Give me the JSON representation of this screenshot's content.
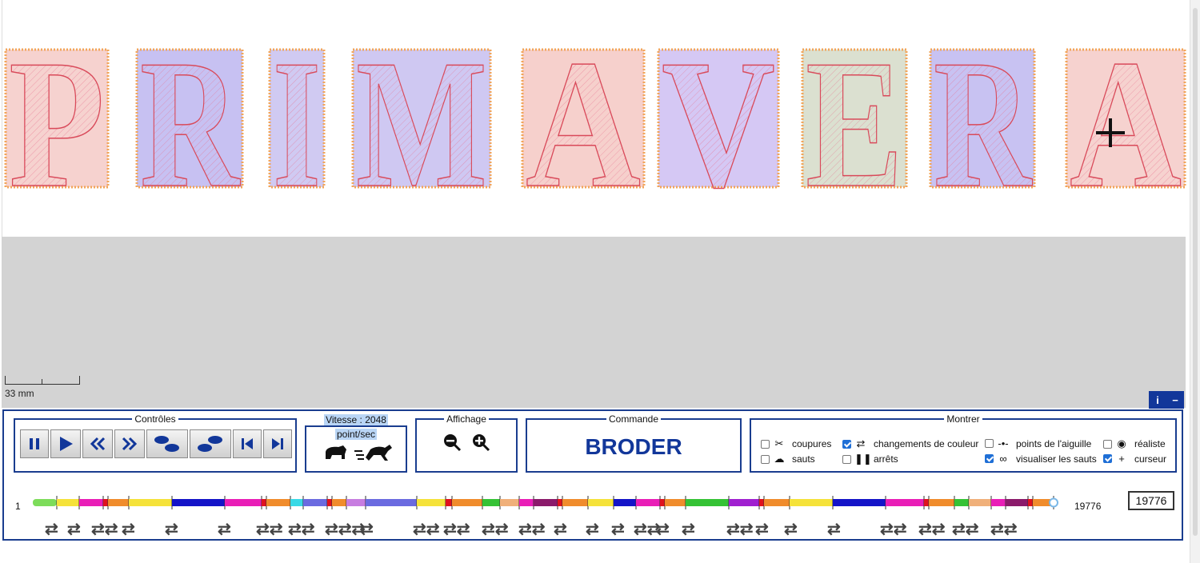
{
  "design": {
    "letters": [
      "P",
      "R",
      "I",
      "M",
      "A",
      "V",
      "E",
      "R",
      "A"
    ]
  },
  "scale": {
    "label": "33 mm"
  },
  "header_buttons": {
    "info": "i",
    "minimize": "−"
  },
  "controls": {
    "legend": "Contrôles",
    "buttons": [
      "pause-icon",
      "play-icon",
      "rewind-icon",
      "fast-forward-icon",
      "step-back-icon",
      "step-forward-icon",
      "first-icon",
      "last-icon"
    ]
  },
  "speed": {
    "line1": "Vitesse : 2048",
    "line2": "point/sec"
  },
  "display": {
    "legend": "Affichage"
  },
  "command": {
    "legend": "Commande",
    "label": "BRODER"
  },
  "show": {
    "legend": "Montrer",
    "options": [
      {
        "label": "coupures",
        "checked": false,
        "icon": "scissors-icon"
      },
      {
        "label": "sauts",
        "checked": false,
        "icon": "jump-icon"
      },
      {
        "label": "changements de couleur",
        "checked": true,
        "icon": "color-change-icon"
      },
      {
        "label": "arrêts",
        "checked": false,
        "icon": "stop-icon"
      },
      {
        "label": "points de l'aiguille",
        "checked": false,
        "icon": "needle-point-icon"
      },
      {
        "label": "visualiser les sauts",
        "checked": true,
        "icon": "link-icon"
      },
      {
        "label": "réaliste",
        "checked": false,
        "icon": "eye-icon"
      },
      {
        "label": "curseur",
        "checked": true,
        "icon": "cursor-icon"
      }
    ]
  },
  "timeline": {
    "start": "1",
    "end": "19776",
    "current": "19776",
    "colors": [
      "#7ddc5a",
      "#f5e23a",
      "#e91eb7",
      "#e0121e",
      "#f08c2c",
      "#f5e23a",
      "#1414c8",
      "#e91eb7",
      "#e0121e",
      "#f08c2c",
      "#39d9e6",
      "#6b6be0",
      "#e0121e",
      "#f08c2c",
      "#c77de0",
      "#6b6be0",
      "#f5e23a",
      "#e0121e",
      "#f08c2c",
      "#35c235",
      "#f0b07a",
      "#e91eb7",
      "#8b1a6b",
      "#e0121e",
      "#f08c2c",
      "#f5e23a",
      "#1414c8",
      "#e91eb7",
      "#e0121e",
      "#f08c2c",
      "#35c235",
      "#a020d0",
      "#e0121e",
      "#f08c2c",
      "#f5e23a",
      "#1414c8",
      "#e91eb7",
      "#e0121e",
      "#f08c2c",
      "#35c235",
      "#f0b07a",
      "#e91eb7",
      "#8b1a6b",
      "#e0121e",
      "#f08c2c"
    ],
    "widths": [
      30,
      28,
      30,
      6,
      26,
      54,
      66,
      46,
      6,
      30,
      16,
      30,
      6,
      18,
      24,
      64,
      36,
      8,
      38,
      22,
      24,
      18,
      30,
      6,
      32,
      32,
      28,
      30,
      6,
      26,
      54,
      38,
      6,
      32,
      54,
      66,
      48,
      6,
      32,
      18,
      28,
      18,
      28,
      6,
      26
    ],
    "arrows": [
      "⇄",
      "⇄",
      "⇄⇄",
      "⇄",
      "⇄",
      "⇄",
      "⇄⇄",
      "⇄⇄",
      "⇄⇄⇄",
      "⇄",
      "⇄⇄",
      "⇄⇄",
      "⇄⇄",
      "⇄⇄",
      "⇄",
      "⇄",
      "⇄",
      "⇄⇄",
      "⇄",
      "⇄",
      "⇄⇄",
      "⇄",
      "⇄",
      "⇄",
      "⇄⇄",
      "⇄⇄",
      "⇄⇄",
      "⇄⇄"
    ]
  }
}
